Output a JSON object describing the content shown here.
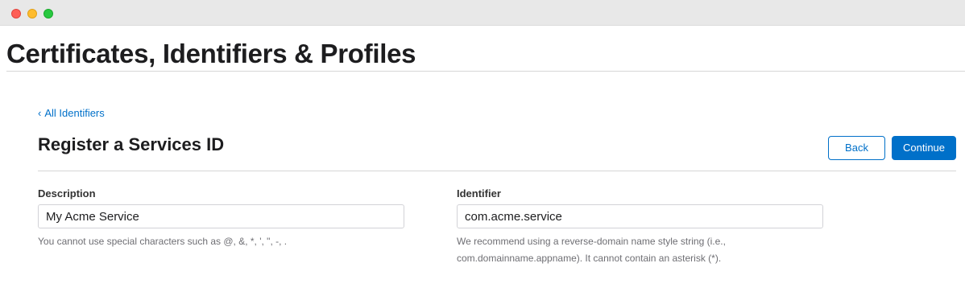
{
  "window": {
    "controls": [
      "close",
      "minimize",
      "zoom"
    ]
  },
  "header": {
    "title": "Certificates, Identifiers & Profiles"
  },
  "nav": {
    "back_chevron": "‹",
    "back_link": "All Identifiers"
  },
  "section": {
    "title": "Register a Services ID",
    "back_button": "Back",
    "continue_button": "Continue"
  },
  "form": {
    "description": {
      "label": "Description",
      "value": "My Acme Service",
      "help": "You cannot use special characters such as @, &, *, ', \", -, ."
    },
    "identifier": {
      "label": "Identifier",
      "value": "com.acme.service",
      "help": "We recommend using a reverse-domain name style string (i.e., com.domainname.appname). It cannot contain an asterisk (*)."
    }
  },
  "colors": {
    "accent": "#0070c9",
    "title_bar": "#e8e8e8",
    "close": "#fe5f57",
    "minimize": "#febc2e",
    "zoom": "#28c840"
  }
}
